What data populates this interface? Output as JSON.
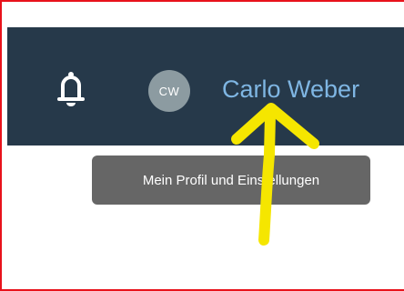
{
  "header": {
    "user_initials": "CW",
    "user_name": "Carlo Weber",
    "bell_icon": "bell-icon"
  },
  "tooltip": {
    "text": "Mein Profil und Einstellungen"
  },
  "annotation": {
    "arrow_color": "#f5e600",
    "frame_color": "#e8121b"
  }
}
